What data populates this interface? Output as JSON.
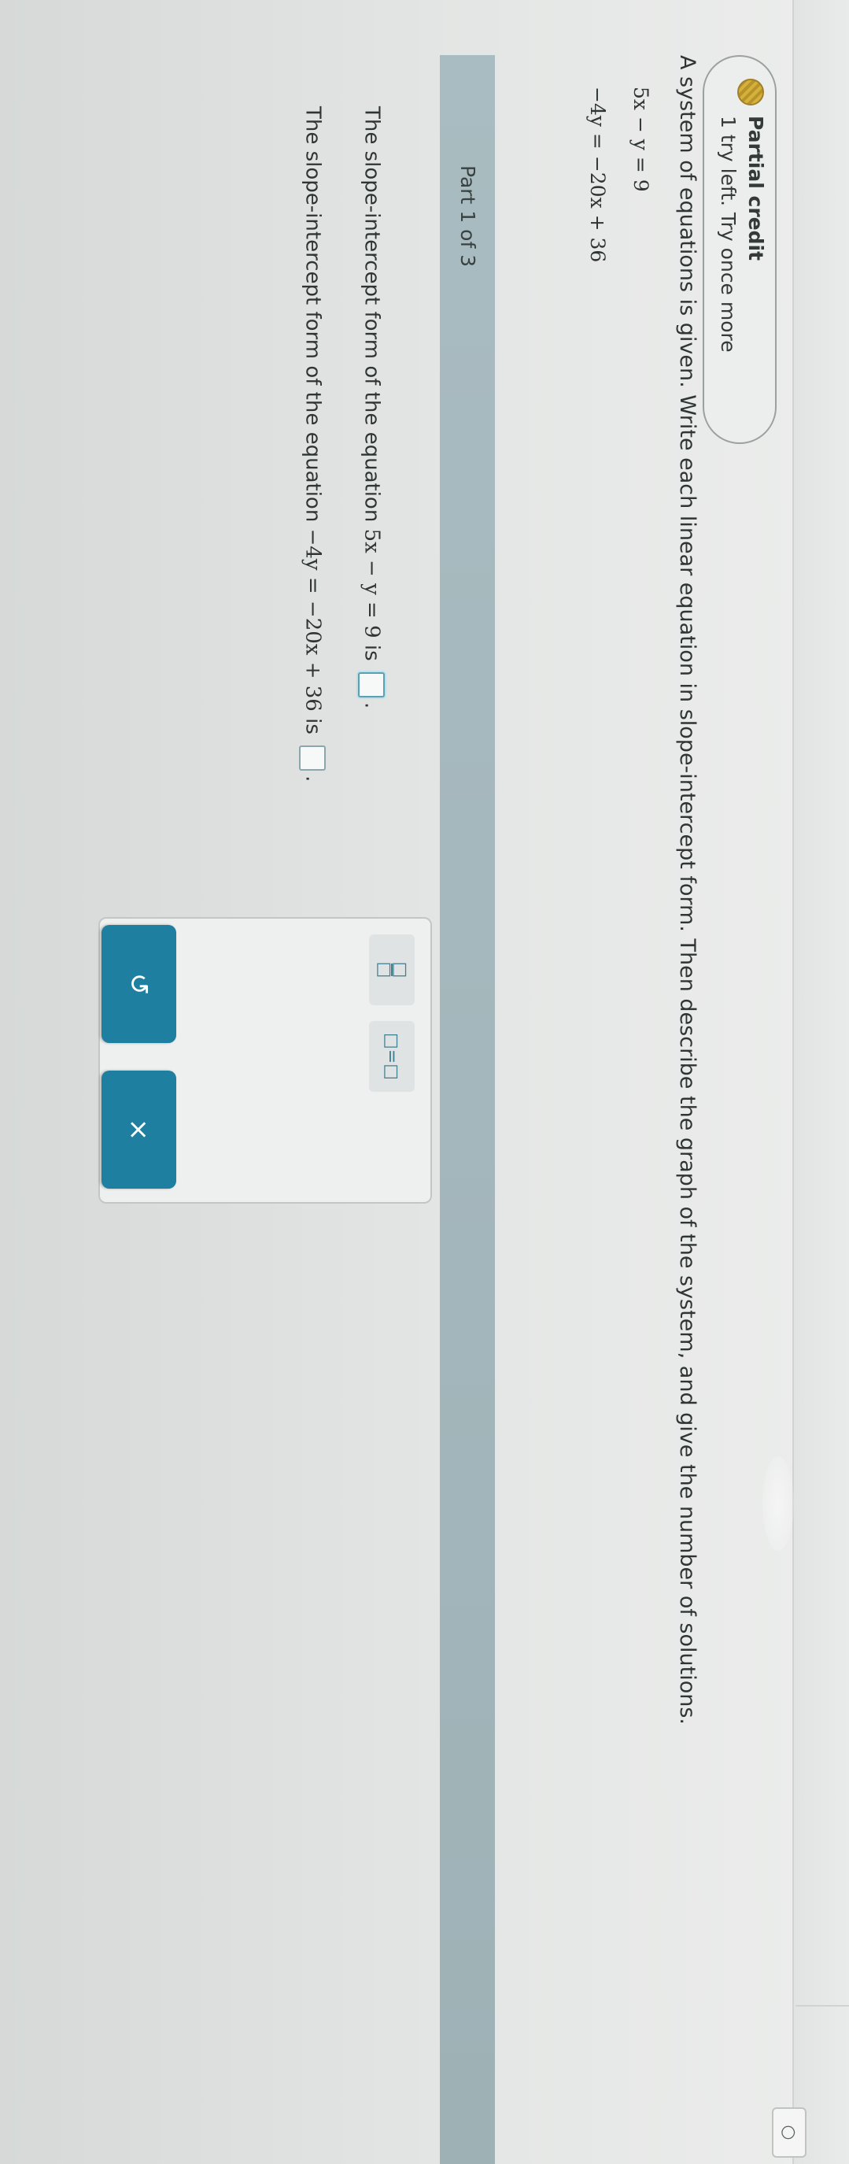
{
  "status": {
    "title": "Partial credit",
    "subtitle": "1 try left. Try once more"
  },
  "problem": {
    "prompt": "A system of equations is given. Write each linear equation in slope-intercept form. Then describe the graph of the system, and give the number of solutions.",
    "equations": [
      "5x − y = 9",
      "−4y = −20x + 36"
    ]
  },
  "part": {
    "label": "Part 1 of 3"
  },
  "questions": [
    {
      "before": "The slope-intercept form of the equation ",
      "math": "5x − y = 9",
      "after": " is",
      "end": "."
    },
    {
      "before": "The slope-intercept form of the equation ",
      "math": "−4y = −20x + 36",
      "after": " is",
      "end": "."
    }
  ],
  "tools": {
    "fraction": "fraction-icon",
    "equals": "□=□"
  },
  "actions": {
    "undo": "↺",
    "clear": "×"
  },
  "icons": {
    "corner": "○"
  },
  "colors": {
    "accent": "#1e7fa0",
    "part_bar": "#a6b9be",
    "badge_dot": "#c9a433"
  }
}
